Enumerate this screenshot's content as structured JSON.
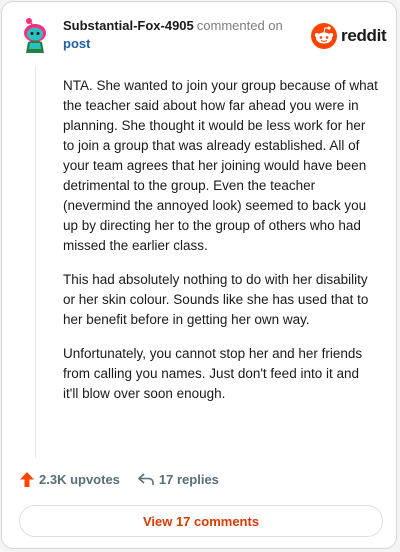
{
  "comment": {
    "username": "Substantial-Fox-4905",
    "action_text": "commented on",
    "target_text": "post",
    "paragraphs": [
      "NTA. She wanted to join your group because of what the teacher said about how far ahead you were in planning. She thought it would be less work for her to join a group that was already established. All of your team agrees that her joining would have been detrimental to the group. Even the teacher (nevermind the annoyed look) seemed to back you up by directing her to the group of others who had missed the earlier class.",
      "This had absolutely nothing to do with her disability or her skin colour. Sounds like she has used that to her benefit before in getting her own way.",
      "Unfortunately, you cannot stop her and her friends from calling you names. Just don't feed into it and it'll blow over soon enough."
    ],
    "upvotes": "2.3K upvotes",
    "replies": "17 replies",
    "view_button": "View 17 comments"
  },
  "brand": {
    "name": "reddit",
    "icon": "reddit-logo-icon",
    "accent": "#ff4500"
  },
  "colors": {
    "upvote": "#ff4500",
    "link": "#1f5fa8",
    "view_button_text": "#d93a00"
  }
}
